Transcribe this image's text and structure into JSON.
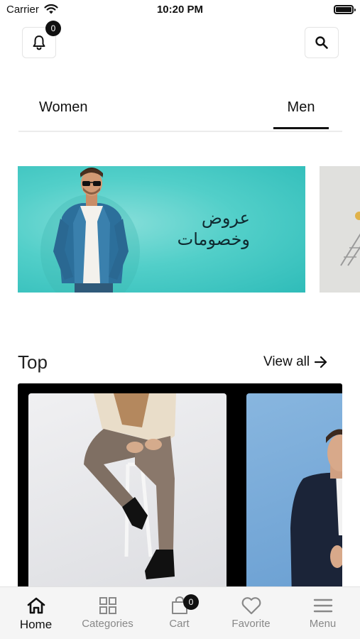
{
  "status_bar": {
    "carrier": "Carrier",
    "time": "10:20 PM"
  },
  "header": {
    "notification_count": "0"
  },
  "tabs": [
    {
      "label": "Women",
      "active": false
    },
    {
      "label": "Men",
      "active": true
    }
  ],
  "banners": [
    {
      "text_line1": "عروض",
      "text_line2": "وخصومات",
      "background": "#4fcfc9"
    }
  ],
  "section": {
    "title": "Top",
    "view_all": "View all"
  },
  "bottom_nav": {
    "items": [
      {
        "label": "Home",
        "icon": "home-icon",
        "active": true
      },
      {
        "label": "Categories",
        "icon": "grid-icon",
        "active": false
      },
      {
        "label": "Cart",
        "icon": "cart-icon",
        "active": false,
        "badge": "0"
      },
      {
        "label": "Favorite",
        "icon": "heart-icon",
        "active": false
      },
      {
        "label": "Menu",
        "icon": "menu-icon",
        "active": false
      }
    ]
  },
  "colors": {
    "accent": "#111111",
    "inactive": "#888888",
    "banner": "#4fcfc9",
    "nav_background": "#f5f5f5"
  }
}
